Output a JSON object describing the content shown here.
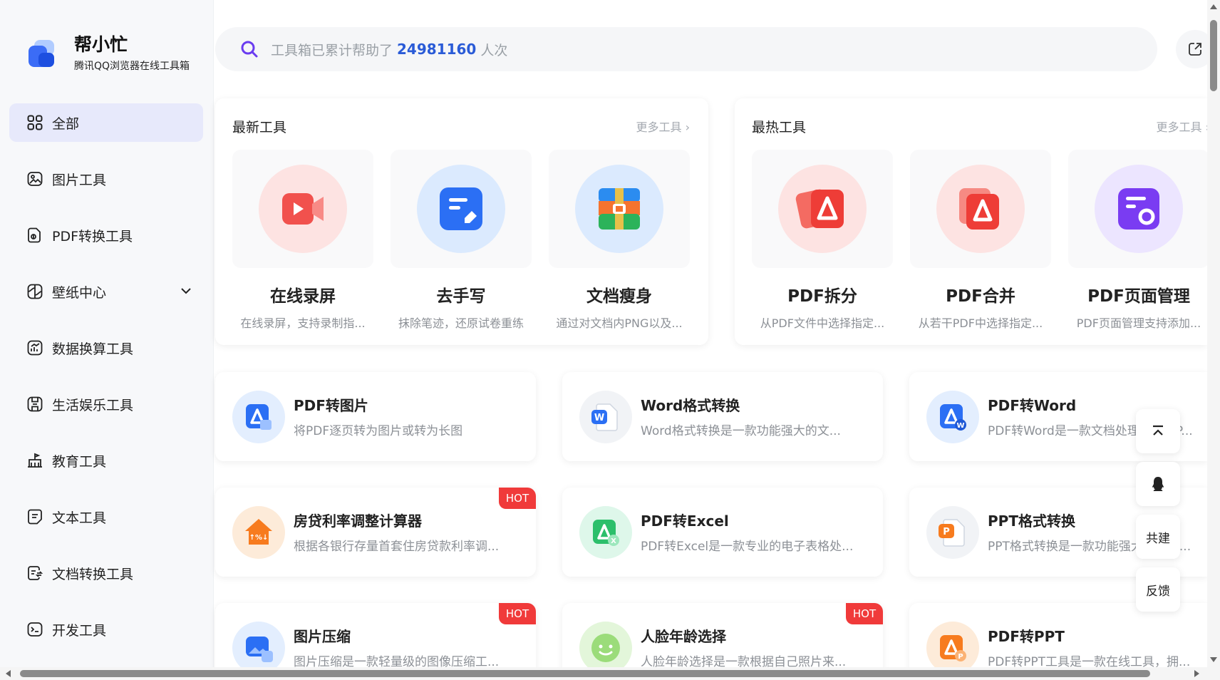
{
  "brand": {
    "title": "帮小忙",
    "subtitle": "腾讯QQ浏览器在线工具箱"
  },
  "nav": [
    {
      "label": "全部",
      "icon": "grid-icon",
      "active": true
    },
    {
      "label": "图片工具",
      "icon": "image-icon"
    },
    {
      "label": "PDF转换工具",
      "icon": "pdf-file-icon"
    },
    {
      "label": "壁纸中心",
      "icon": "wallpaper-icon",
      "expandable": true
    },
    {
      "label": "数据换算工具",
      "icon": "chart-icon"
    },
    {
      "label": "生活娱乐工具",
      "icon": "game-icon"
    },
    {
      "label": "教育工具",
      "icon": "school-icon"
    },
    {
      "label": "文本工具",
      "icon": "text-file-icon"
    },
    {
      "label": "文档转换工具",
      "icon": "doc-convert-icon"
    },
    {
      "label": "开发工具",
      "icon": "terminal-icon"
    }
  ],
  "search": {
    "prefix": "工具箱已累计帮助了",
    "count": "24981160",
    "suffix": "人次"
  },
  "latest": {
    "title": "最新工具",
    "more": "更多工具",
    "items": [
      {
        "name": "在线录屏",
        "desc": "在线录屏，支持录制指...",
        "icon": "screen-record-icon"
      },
      {
        "name": "去手写",
        "desc": "抹除笔迹，还原试卷重练",
        "icon": "erase-handwriting-icon"
      },
      {
        "name": "文档瘦身",
        "desc": "通过对文档内PNG以及...",
        "icon": "compress-archive-icon"
      }
    ]
  },
  "hottest": {
    "title": "最热工具",
    "more": "更多工具",
    "items": [
      {
        "name": "PDF拆分",
        "desc": "从PDF文件中选择指定...",
        "icon": "pdf-split-icon"
      },
      {
        "name": "PDF合并",
        "desc": "从若干PDF中选择指定...",
        "icon": "pdf-merge-icon"
      },
      {
        "name": "PDF页面管理",
        "desc": "PDF页面管理支持添加...",
        "icon": "pdf-page-manage-icon"
      }
    ]
  },
  "cards": [
    {
      "name": "PDF转图片",
      "desc": "将PDF逐页转为图片或转为长图",
      "icon": "pdf-to-image-icon",
      "hot": false
    },
    {
      "name": "Word格式转换",
      "desc": "Word格式转换是一款功能强大的文...",
      "icon": "word-icon",
      "hot": false
    },
    {
      "name": "PDF转Word",
      "desc": "PDF转Word是一款文档处理工具，P...",
      "icon": "pdf-to-word-icon",
      "hot": false
    },
    {
      "name": "房贷利率调整计算器",
      "desc": "根据各银行存量首套住房贷款利率调...",
      "icon": "house-rate-icon",
      "hot": true
    },
    {
      "name": "PDF转Excel",
      "desc": "PDF转Excel是一款专业的电子表格处...",
      "icon": "pdf-to-excel-icon",
      "hot": false
    },
    {
      "name": "PPT格式转换",
      "desc": "PPT格式转换是一款功能强大的工具...",
      "icon": "ppt-icon",
      "hot": false
    },
    {
      "name": "图片压缩",
      "desc": "图片压缩是一款轻量级的图像压缩工...",
      "icon": "image-compress-icon",
      "hot": true
    },
    {
      "name": "人脸年龄选择",
      "desc": "人脸年龄选择是一款根据自己照片来...",
      "icon": "face-age-icon",
      "hot": true
    },
    {
      "name": "PDF转PPT",
      "desc": "PDF转PPT工具是一款在线工具，拥...",
      "icon": "pdf-to-ppt-icon",
      "hot": false
    }
  ],
  "hot_label": "HOT",
  "float": {
    "cobuild": "共建",
    "feedback": "反馈"
  }
}
